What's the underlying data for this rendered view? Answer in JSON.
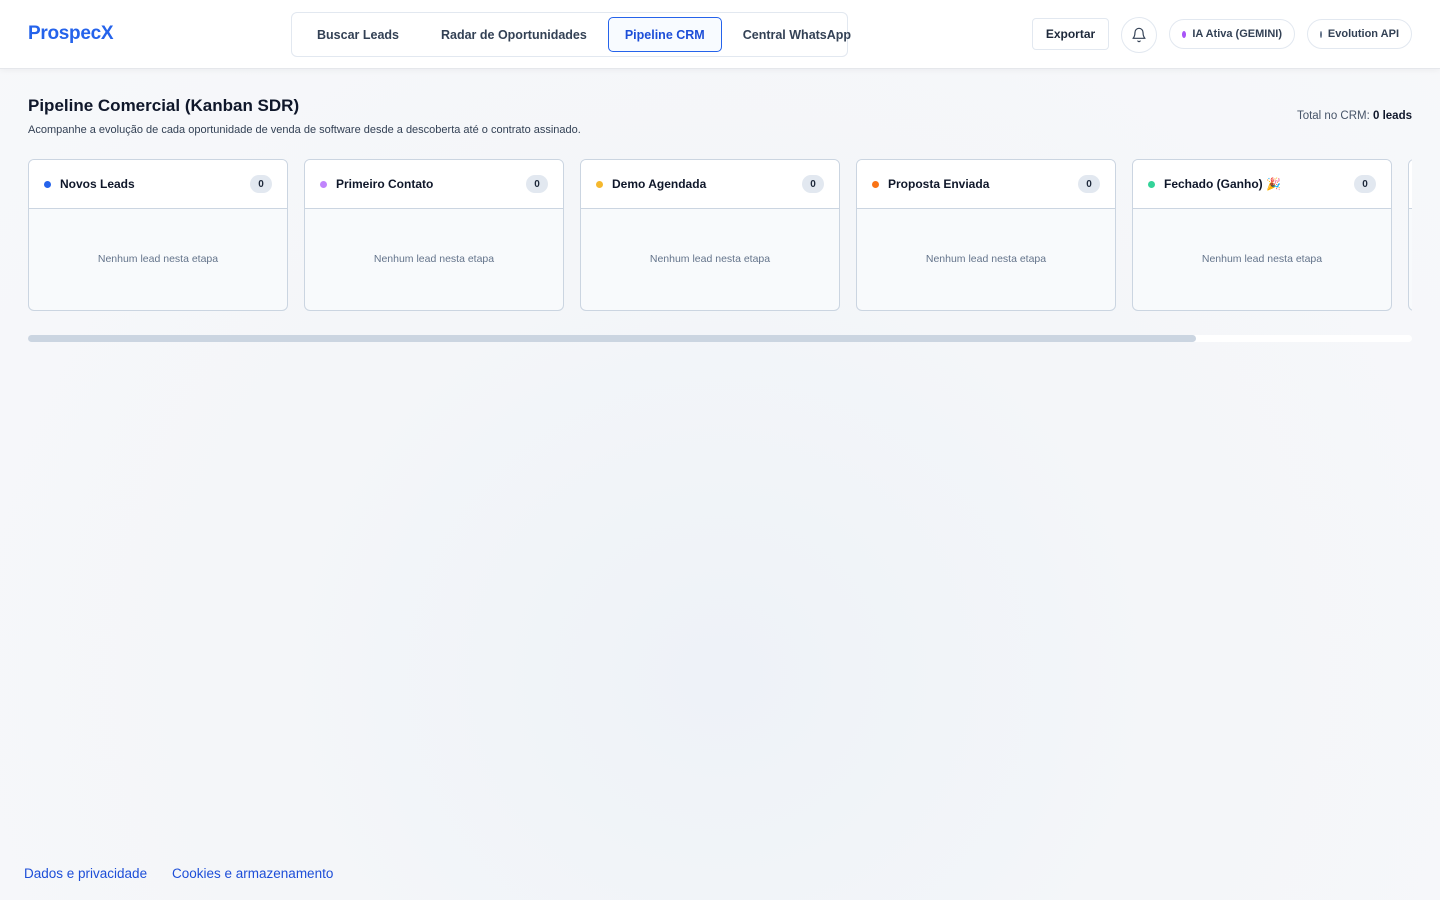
{
  "app": {
    "logo": "ProspecX"
  },
  "nav": {
    "tabs": [
      {
        "label": "Buscar Leads",
        "active": false
      },
      {
        "label": "Radar de Oportunidades",
        "active": false
      },
      {
        "label": "Pipeline CRM",
        "active": true
      },
      {
        "label": "Central WhatsApp",
        "active": false
      }
    ]
  },
  "header": {
    "export_label": "Exportar",
    "ai_status": {
      "label": "IA Ativa (GEMINI)",
      "color": "#a855f7"
    },
    "api_status": {
      "label": "Evolution API",
      "color": "#64748b"
    }
  },
  "page": {
    "title": "Pipeline Comercial (Kanban SDR)",
    "subtitle": "Acompanhe a evolução de cada oportunidade de venda de software desde a descoberta até o contrato assinado.",
    "total_prefix": "Total no CRM:",
    "total_value": "0 leads"
  },
  "board": {
    "columns": [
      {
        "title": "Novos Leads",
        "count": "0",
        "color": "#2563eb",
        "empty": "Nenhum lead nesta etapa"
      },
      {
        "title": "Primeiro Contato",
        "count": "0",
        "color": "#c084fc",
        "empty": "Nenhum lead nesta etapa"
      },
      {
        "title": "Demo Agendada",
        "count": "0",
        "color": "#f5b82e",
        "empty": "Nenhum lead nesta etapa"
      },
      {
        "title": "Proposta Enviada",
        "count": "0",
        "color": "#f97316",
        "empty": "Nenhum lead nesta etapa"
      },
      {
        "title": "Fechado (Ganho) 🎉",
        "count": "0",
        "color": "#34d399",
        "empty": "Nenhum lead nesta etapa"
      },
      {
        "title": "",
        "count": "",
        "color": "#94a3b8",
        "empty": ""
      }
    ],
    "scroll_fraction": 0.844
  },
  "footer": {
    "privacy_link": "Dados e privacidade",
    "cookies_link": "Cookies e armazenamento"
  }
}
